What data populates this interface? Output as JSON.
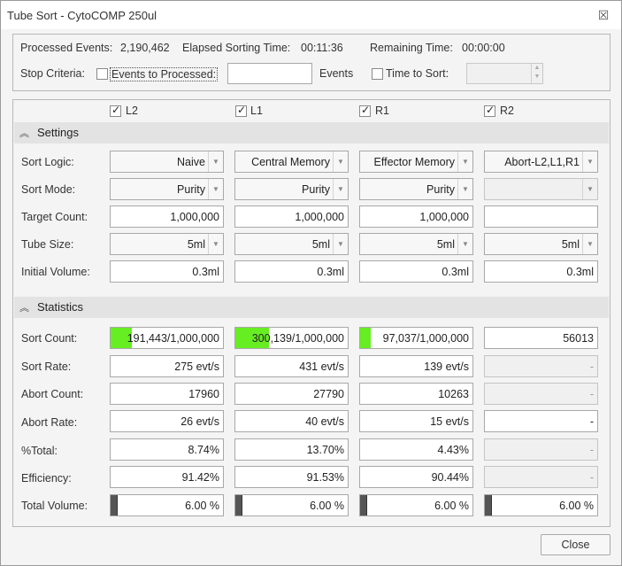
{
  "window": {
    "title": "Tube Sort - CytoCOMP 250ul"
  },
  "status": {
    "processed_label": "Processed Events:",
    "processed_value": "2,190,462",
    "elapsed_label": "Elapsed Sorting Time:",
    "elapsed_value": "00:11:36",
    "remaining_label": "Remaining Time:",
    "remaining_value": "00:00:00"
  },
  "stop": {
    "label": "Stop Criteria:",
    "events_label": "Events to Processed:",
    "events_value": "",
    "events_unit": "Events",
    "time_label": "Time to Sort:",
    "time_value": ""
  },
  "columns": [
    {
      "label": "L2",
      "checked": true
    },
    {
      "label": "L1",
      "checked": true
    },
    {
      "label": "R1",
      "checked": true
    },
    {
      "label": "R2",
      "checked": true
    }
  ],
  "settings": {
    "title": "Settings",
    "row_labels": {
      "sort_logic": "Sort Logic:",
      "sort_mode": "Sort Mode:",
      "target_count": "Target Count:",
      "tube_size": "Tube Size:",
      "initial_volume": "Initial Volume:"
    },
    "sort_logic": [
      "Naive",
      "Central Memory",
      "Effector Memory",
      "Abort-L2,L1,R1"
    ],
    "sort_mode": [
      "Purity",
      "Purity",
      "Purity",
      ""
    ],
    "target_count": [
      "1,000,000",
      "1,000,000",
      "1,000,000",
      ""
    ],
    "tube_size": [
      "5ml",
      "5ml",
      "5ml",
      "5ml"
    ],
    "initial_volume": [
      "0.3ml",
      "0.3ml",
      "0.3ml",
      "0.3ml"
    ]
  },
  "statistics": {
    "title": "Statistics",
    "row_labels": {
      "sort_count": "Sort Count:",
      "sort_rate": "Sort Rate:",
      "abort_count": "Abort Count:",
      "abort_rate": "Abort Rate:",
      "pct_total": "%Total:",
      "efficiency": "Efficiency:",
      "total_volume": "Total Volume:"
    },
    "sort_count": [
      "191,443/1,000,000",
      "300,139/1,000,000",
      "97,037/1,000,000",
      "56013"
    ],
    "sort_count_progress": [
      0.191,
      0.3,
      0.097,
      null
    ],
    "sort_rate": [
      "275 evt/s",
      "431 evt/s",
      "139 evt/s",
      "-"
    ],
    "abort_count": [
      "17960",
      "27790",
      "10263",
      "-"
    ],
    "abort_rate": [
      "26 evt/s",
      "40 evt/s",
      "15 evt/s",
      "-"
    ],
    "pct_total": [
      "8.74%",
      "13.70%",
      "4.43%",
      "-"
    ],
    "efficiency": [
      "91.42%",
      "91.53%",
      "90.44%",
      "-"
    ],
    "total_volume": [
      "6.00 %",
      "6.00 %",
      "6.00 %",
      "6.00 %"
    ],
    "total_volume_progress": [
      0.06,
      0.06,
      0.06,
      0.06
    ]
  },
  "footer": {
    "close_label": "Close"
  },
  "colors": {
    "progress_fill": "#66ee22",
    "volume_fill": "#555555"
  }
}
